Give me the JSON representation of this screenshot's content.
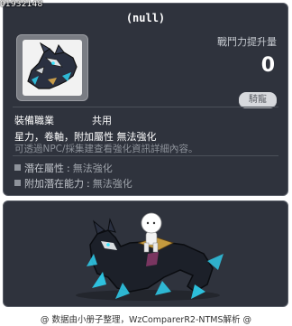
{
  "tooltip": {
    "item_code": "01932148",
    "item_name": "(null)",
    "power_label": "戰鬥力提升量",
    "power_value": "0",
    "badge": "騎寵",
    "job_label": "裝備職業",
    "job_value": "共用",
    "attributes": "星力，卷軸，附加屬性 無法強化",
    "hint": "可透過NPC/採集建查看強化資訊詳細內容。",
    "potential": {
      "label": "潛在屬性",
      "separator": ":",
      "value": "無法強化"
    },
    "bonus_potential": {
      "label": "附加潛在能力",
      "separator": ":",
      "value": "無法強化"
    }
  },
  "footer": "@ 数据由小册子整理，WzComparerR2-NTMS解析 @"
}
